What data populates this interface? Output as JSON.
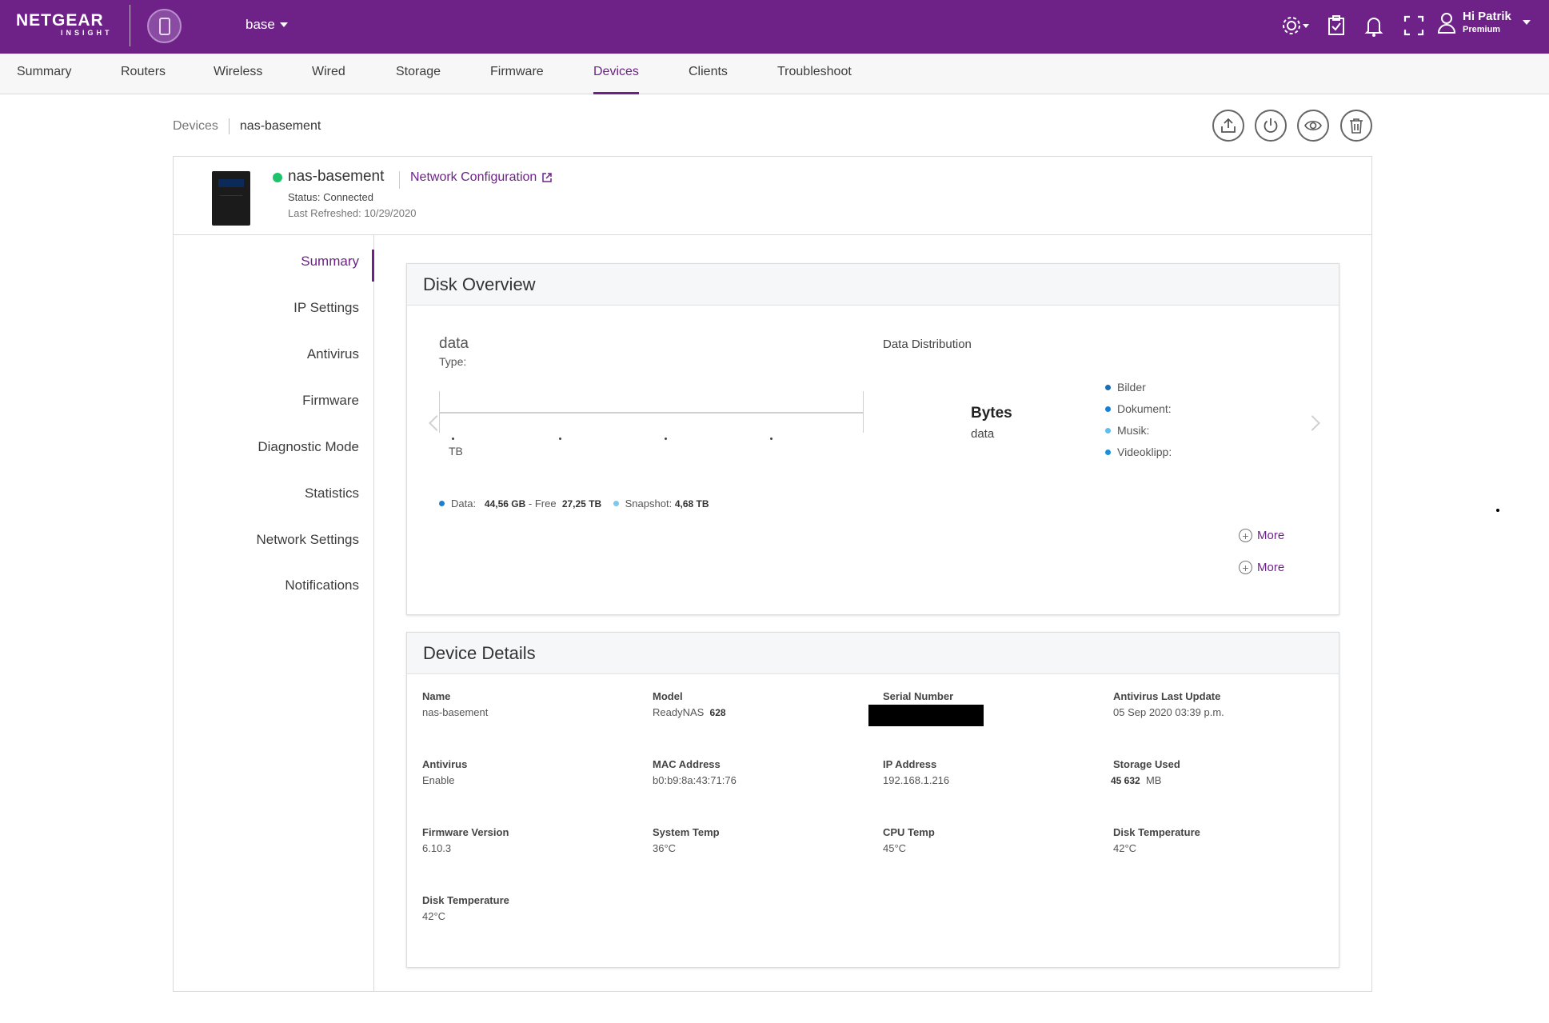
{
  "header": {
    "brand": "NETGEAR",
    "brand_sub": "INSIGHT",
    "site_name": "base",
    "user_greeting": "Hi Patrik",
    "user_tier": "Premium",
    "accent_color": "#6e2288"
  },
  "nav": {
    "tabs": [
      "Summary",
      "Routers",
      "Wireless",
      "Wired",
      "Storage",
      "Firmware",
      "Devices",
      "Clients",
      "Troubleshoot"
    ],
    "active": "Devices"
  },
  "breadcrumb": {
    "parent": "Devices",
    "current": "nas-basement"
  },
  "device": {
    "name": "nas-basement",
    "link": "Network Configuration",
    "status": "Status: Connected",
    "refreshed": "Last Refreshed: 10/29/2020",
    "status_color": "#1dc36a"
  },
  "side_menu": {
    "items": [
      "Summary",
      "IP Settings",
      "Antivirus",
      "Firmware",
      "Diagnostic Mode",
      "Statistics",
      "Network Settings",
      "Notifications"
    ],
    "active": "Summary"
  },
  "disk_overview": {
    "title": "Disk Overview",
    "volume": "data",
    "type_label": "Type:",
    "unit": "TB",
    "legend": {
      "data_label": "Data:",
      "data_value": "44,56 GB",
      "free_label": "- Free",
      "free_value": "27,25 TB",
      "snapshot_label": "Snapshot:",
      "snapshot_value": "4,68 TB"
    },
    "distribution": {
      "title": "Data Distribution",
      "center_title": "Bytes",
      "center_sub": "data",
      "items": [
        "Bilder",
        "Dokument:",
        "Musik:",
        "Videoklipp:"
      ]
    },
    "more_label": "More"
  },
  "device_details": {
    "title": "Device Details",
    "fields": {
      "name": {
        "label": "Name",
        "value": "nas-basement"
      },
      "model": {
        "label": "Model",
        "value": "ReadyNAS",
        "value_bold": "628"
      },
      "serial": {
        "label": "Serial Number"
      },
      "av_update": {
        "label": "Antivirus Last Update",
        "value": "05 Sep 2020 03:39 p.m."
      },
      "antivirus": {
        "label": "Antivirus",
        "value": "Enable"
      },
      "mac": {
        "label": "MAC Address",
        "value": "b0:b9:8a:43:71:76"
      },
      "ip": {
        "label": "IP Address",
        "value": "192.168.1.216"
      },
      "storage": {
        "label": "Storage Used",
        "value_bold": "45 632",
        "value": "MB"
      },
      "firmware": {
        "label": "Firmware Version",
        "value": "6.10.3"
      },
      "sys_temp": {
        "label": "System Temp",
        "value": "36°C"
      },
      "cpu_temp": {
        "label": "CPU Temp",
        "value": "45°C"
      },
      "disk_temp1": {
        "label": "Disk Temperature",
        "value": "42°C"
      },
      "disk_temp2": {
        "label": "Disk Temperature",
        "value": "42°C"
      }
    }
  }
}
